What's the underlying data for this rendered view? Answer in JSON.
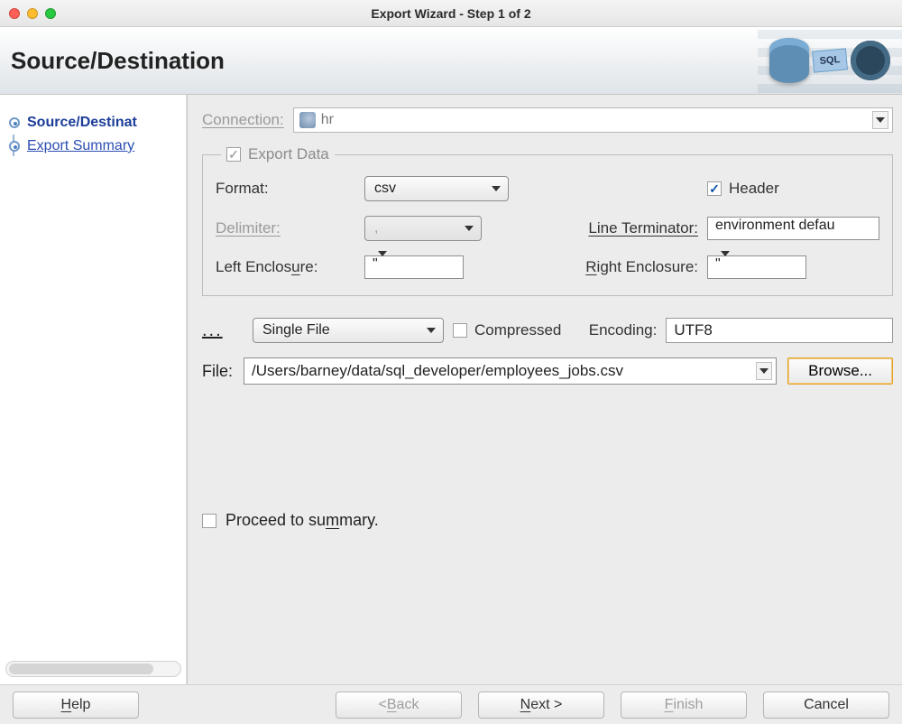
{
  "window": {
    "title": "Export Wizard - Step 1 of 2"
  },
  "page_heading": "Source/Destination",
  "steps": [
    {
      "label": "Source/Destinat",
      "active": true
    },
    {
      "label": "Export Summary",
      "active": false
    }
  ],
  "connection": {
    "label": "Connection:",
    "value": "hr"
  },
  "export_panel": {
    "title": "Export Data",
    "checked": true,
    "format_label": "Format:",
    "format_value": "csv",
    "header_label": "Header",
    "header_checked": true,
    "delimiter_label": "Delimiter:",
    "delimiter_value": ",",
    "line_term_label": "Line Terminator:",
    "line_term_value": "environment defau",
    "left_enc_label": "Left Enclosure:",
    "left_enc_value": "\"",
    "right_enc_label": "Right Enclosure:",
    "right_enc_value": "\""
  },
  "output": {
    "dots": "...",
    "mode": "Single File",
    "compressed_label": "Compressed",
    "compressed_checked": false,
    "encoding_label": "Encoding:",
    "encoding_value": "UTF8",
    "file_label": "File:",
    "file_value": "/Users/barney/data/sql_developer/employees_jobs.csv",
    "browse_label": "Browse..."
  },
  "proceed_label": "Proceed to summary.",
  "buttons": {
    "help": "Help",
    "back": "< Back",
    "next": "Next >",
    "finish": "Finish",
    "cancel": "Cancel"
  }
}
